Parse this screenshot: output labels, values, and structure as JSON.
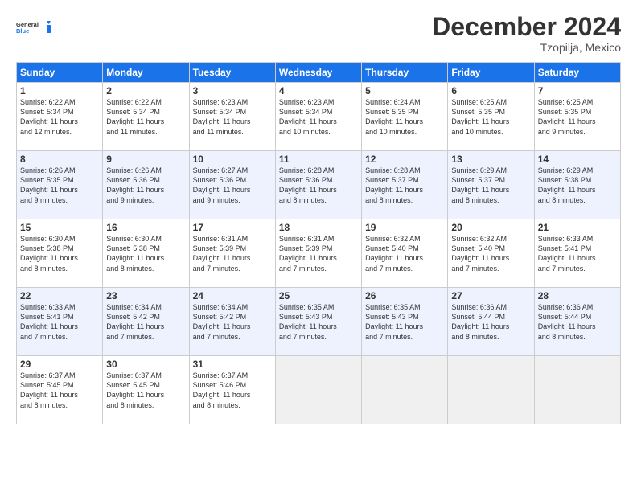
{
  "logo": {
    "line1": "General",
    "line2": "Blue"
  },
  "title": "December 2024",
  "subtitle": "Tzopilja, Mexico",
  "days_header": [
    "Sunday",
    "Monday",
    "Tuesday",
    "Wednesday",
    "Thursday",
    "Friday",
    "Saturday"
  ],
  "weeks": [
    [
      {
        "day": "1",
        "sunrise": "6:22 AM",
        "sunset": "5:34 PM",
        "daylight": "11 hours and 12 minutes."
      },
      {
        "day": "2",
        "sunrise": "6:22 AM",
        "sunset": "5:34 PM",
        "daylight": "11 hours and 11 minutes."
      },
      {
        "day": "3",
        "sunrise": "6:23 AM",
        "sunset": "5:34 PM",
        "daylight": "11 hours and 11 minutes."
      },
      {
        "day": "4",
        "sunrise": "6:23 AM",
        "sunset": "5:34 PM",
        "daylight": "11 hours and 10 minutes."
      },
      {
        "day": "5",
        "sunrise": "6:24 AM",
        "sunset": "5:35 PM",
        "daylight": "11 hours and 10 minutes."
      },
      {
        "day": "6",
        "sunrise": "6:25 AM",
        "sunset": "5:35 PM",
        "daylight": "11 hours and 10 minutes."
      },
      {
        "day": "7",
        "sunrise": "6:25 AM",
        "sunset": "5:35 PM",
        "daylight": "11 hours and 9 minutes."
      }
    ],
    [
      {
        "day": "8",
        "sunrise": "6:26 AM",
        "sunset": "5:35 PM",
        "daylight": "11 hours and 9 minutes."
      },
      {
        "day": "9",
        "sunrise": "6:26 AM",
        "sunset": "5:36 PM",
        "daylight": "11 hours and 9 minutes."
      },
      {
        "day": "10",
        "sunrise": "6:27 AM",
        "sunset": "5:36 PM",
        "daylight": "11 hours and 9 minutes."
      },
      {
        "day": "11",
        "sunrise": "6:28 AM",
        "sunset": "5:36 PM",
        "daylight": "11 hours and 8 minutes."
      },
      {
        "day": "12",
        "sunrise": "6:28 AM",
        "sunset": "5:37 PM",
        "daylight": "11 hours and 8 minutes."
      },
      {
        "day": "13",
        "sunrise": "6:29 AM",
        "sunset": "5:37 PM",
        "daylight": "11 hours and 8 minutes."
      },
      {
        "day": "14",
        "sunrise": "6:29 AM",
        "sunset": "5:38 PM",
        "daylight": "11 hours and 8 minutes."
      }
    ],
    [
      {
        "day": "15",
        "sunrise": "6:30 AM",
        "sunset": "5:38 PM",
        "daylight": "11 hours and 8 minutes."
      },
      {
        "day": "16",
        "sunrise": "6:30 AM",
        "sunset": "5:38 PM",
        "daylight": "11 hours and 8 minutes."
      },
      {
        "day": "17",
        "sunrise": "6:31 AM",
        "sunset": "5:39 PM",
        "daylight": "11 hours and 7 minutes."
      },
      {
        "day": "18",
        "sunrise": "6:31 AM",
        "sunset": "5:39 PM",
        "daylight": "11 hours and 7 minutes."
      },
      {
        "day": "19",
        "sunrise": "6:32 AM",
        "sunset": "5:40 PM",
        "daylight": "11 hours and 7 minutes."
      },
      {
        "day": "20",
        "sunrise": "6:32 AM",
        "sunset": "5:40 PM",
        "daylight": "11 hours and 7 minutes."
      },
      {
        "day": "21",
        "sunrise": "6:33 AM",
        "sunset": "5:41 PM",
        "daylight": "11 hours and 7 minutes."
      }
    ],
    [
      {
        "day": "22",
        "sunrise": "6:33 AM",
        "sunset": "5:41 PM",
        "daylight": "11 hours and 7 minutes."
      },
      {
        "day": "23",
        "sunrise": "6:34 AM",
        "sunset": "5:42 PM",
        "daylight": "11 hours and 7 minutes."
      },
      {
        "day": "24",
        "sunrise": "6:34 AM",
        "sunset": "5:42 PM",
        "daylight": "11 hours and 7 minutes."
      },
      {
        "day": "25",
        "sunrise": "6:35 AM",
        "sunset": "5:43 PM",
        "daylight": "11 hours and 7 minutes."
      },
      {
        "day": "26",
        "sunrise": "6:35 AM",
        "sunset": "5:43 PM",
        "daylight": "11 hours and 7 minutes."
      },
      {
        "day": "27",
        "sunrise": "6:36 AM",
        "sunset": "5:44 PM",
        "daylight": "11 hours and 8 minutes."
      },
      {
        "day": "28",
        "sunrise": "6:36 AM",
        "sunset": "5:44 PM",
        "daylight": "11 hours and 8 minutes."
      }
    ],
    [
      {
        "day": "29",
        "sunrise": "6:37 AM",
        "sunset": "5:45 PM",
        "daylight": "11 hours and 8 minutes."
      },
      {
        "day": "30",
        "sunrise": "6:37 AM",
        "sunset": "5:45 PM",
        "daylight": "11 hours and 8 minutes."
      },
      {
        "day": "31",
        "sunrise": "6:37 AM",
        "sunset": "5:46 PM",
        "daylight": "11 hours and 8 minutes."
      },
      null,
      null,
      null,
      null
    ]
  ],
  "labels": {
    "sunrise": "Sunrise:",
    "sunset": "Sunset:",
    "daylight": "Daylight:"
  }
}
